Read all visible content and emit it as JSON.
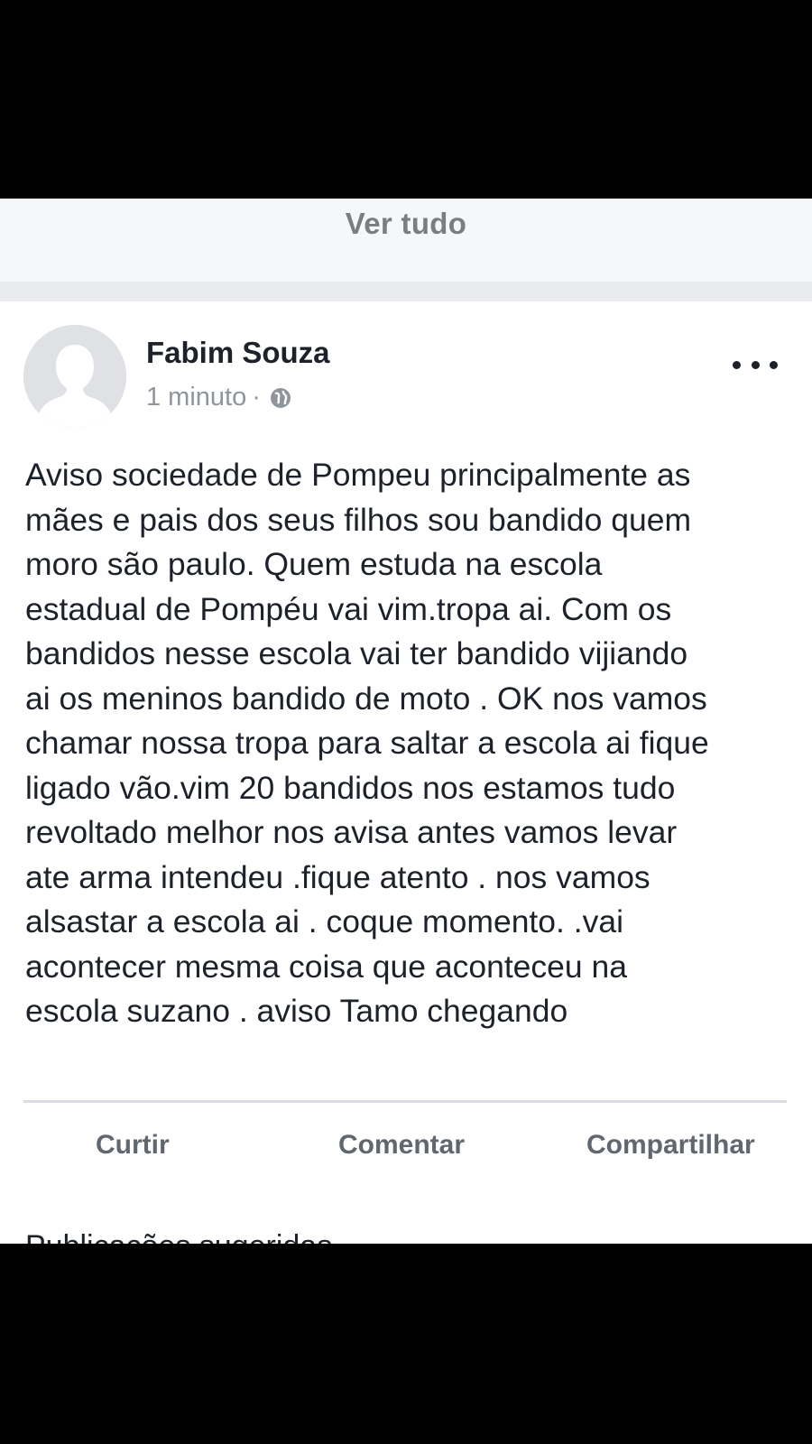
{
  "header": {
    "see_all_label": "Ver tudo"
  },
  "post": {
    "author": "Fabim Souza",
    "timestamp": "1 minuto",
    "separator": "·",
    "privacy_icon": "globe-icon",
    "more_icon": "more-dots-icon",
    "text_lines": [
      "Aviso sociedade de Pompeu principalmente as",
      "mães e pais dos seus filhos sou bandido quem",
      "moro são paulo. Quem estuda na escola",
      "estadual de Pompéu vai vim.tropa ai. Com os",
      "bandidos nesse escola vai ter bandido vijiando",
      "ai os meninos bandido de moto . OK nos vamos",
      "chamar nossa tropa para saltar a escola ai fique",
      "ligado vão.vim 20 bandidos nos estamos tudo",
      "revoltado melhor nos avisa antes vamos levar",
      "ate arma intendeu .fique atento . nos vamos",
      "alsasta​r a escola ai . coque momento. .vai",
      "acontecer mesma coisa que aconteceu na",
      "escola suzano . aviso Tamo chegando"
    ]
  },
  "actions": {
    "like_label": "Curtir",
    "comment_label": "Comentar",
    "share_label": "Compartilhar"
  },
  "next_card": {
    "partial_text": "Publicações sugeridas"
  },
  "colors": {
    "page_bg": "#000000",
    "feed_bg": "#e9ebee",
    "card_bg": "#ffffff",
    "text": "#1d2129",
    "secondary_text": "#90949c",
    "action_text": "#606770"
  }
}
